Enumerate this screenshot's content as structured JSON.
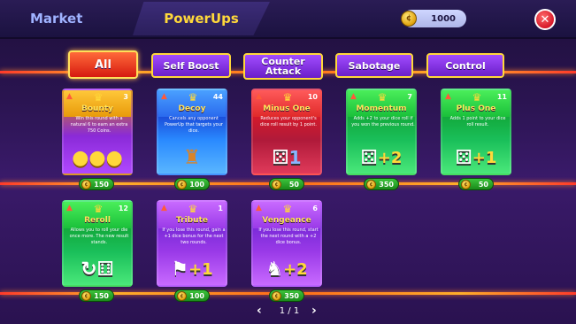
{
  "nav": {
    "market_label": "Market",
    "powerups_label": "PowerUps",
    "coin_balance": "1000"
  },
  "categories": [
    {
      "label": "All",
      "active": true
    },
    {
      "label": "Self Boost",
      "active": false
    },
    {
      "label": "Counter Attack",
      "active": false
    },
    {
      "label": "Sabotage",
      "active": false
    },
    {
      "label": "Control",
      "active": false
    }
  ],
  "cards": [
    {
      "title": "Bounty",
      "count": "3",
      "desc": "Win this round with a natural 6 to earn an extra 750 Coins.",
      "price": "150",
      "color": "yellow",
      "art": "gold-coins-icon"
    },
    {
      "title": "Decoy",
      "count": "44",
      "desc": "Cancels any opponent PowerUp that targets your dice.",
      "price": "100",
      "color": "blue",
      "art": "scarecrow-icon"
    },
    {
      "title": "Minus One",
      "count": "10",
      "desc": "Reduces your opponent's dice roll result by 1 point.",
      "price": "50",
      "color": "red",
      "art": "dice-minus-one-icon"
    },
    {
      "title": "Momentum",
      "count": "7",
      "desc": "Adds +2 to your dice roll if you won the previous round.",
      "price": "350",
      "color": "green",
      "art": "dice-plus-two-icon"
    },
    {
      "title": "Plus One",
      "count": "11",
      "desc": "Adds 1 point to your dice roll result.",
      "price": "50",
      "color": "green",
      "art": "dice-plus-one-icon"
    },
    {
      "title": "Reroll",
      "count": "12",
      "desc": "Allows you to roll your die once more. The new result stands.",
      "price": "150",
      "color": "green",
      "art": "reroll-dice-icon"
    },
    {
      "title": "Tribute",
      "count": "1",
      "desc": "If you lose this round, gain a +1 dice bonus for the next two rounds.",
      "price": "100",
      "color": "purple",
      "art": "flag-plus-one-icon"
    },
    {
      "title": "Vengeance",
      "count": "6",
      "desc": "If you lose this round, start the next round with a +2 dice bonus.",
      "price": "350",
      "color": "purple",
      "art": "vengeance-plus-two-icon"
    }
  ],
  "pager": {
    "label": "1 / 1"
  }
}
